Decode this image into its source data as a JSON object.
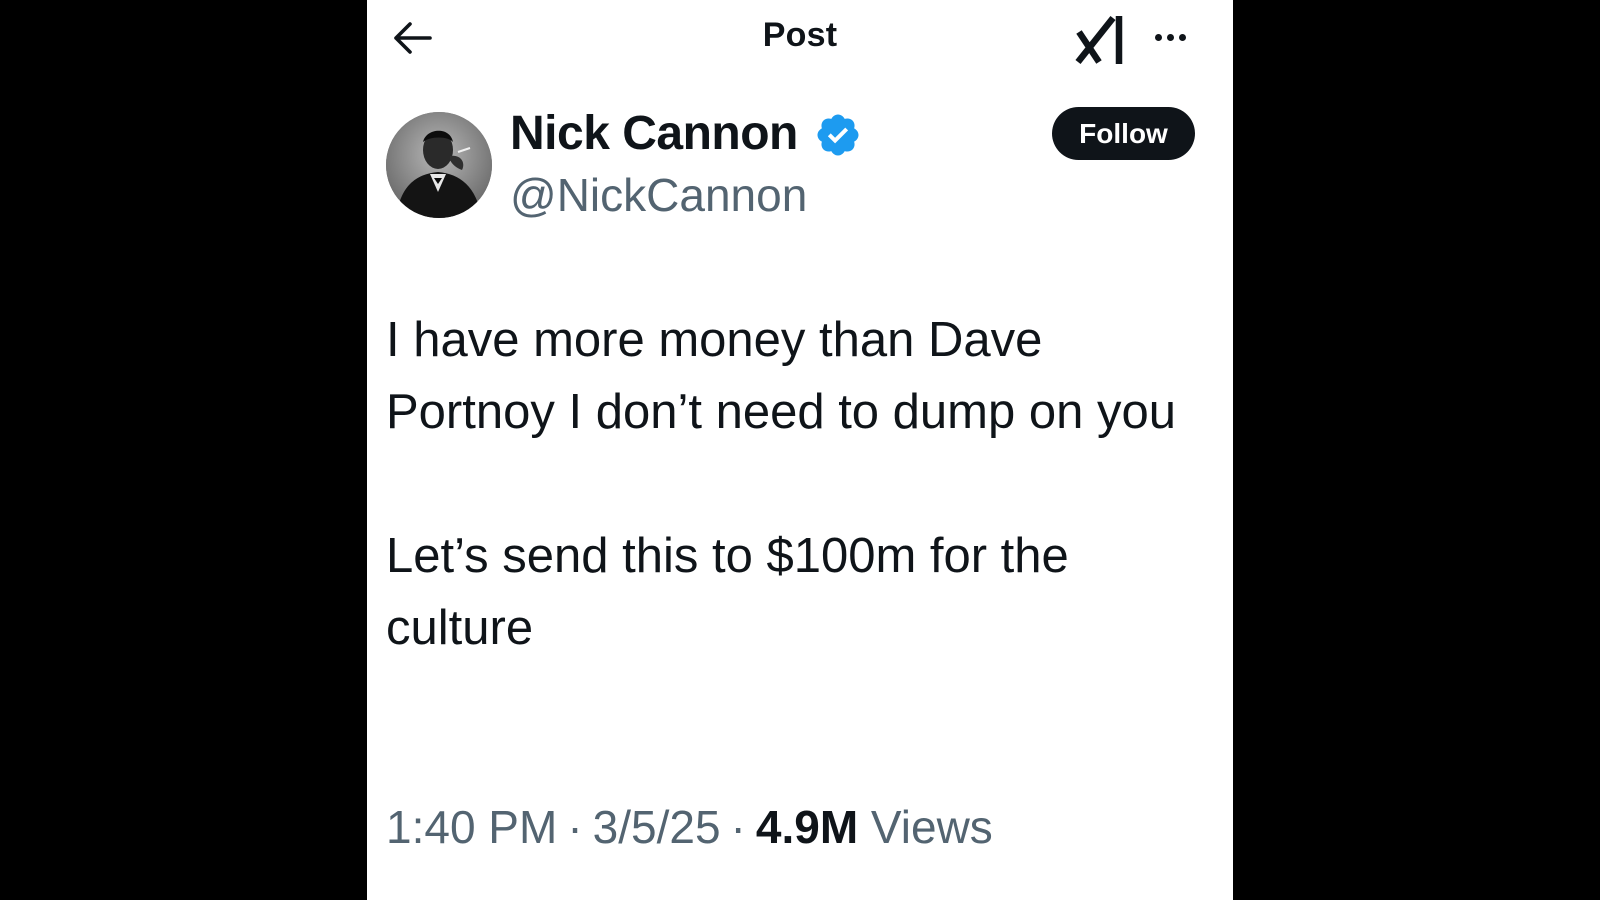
{
  "header": {
    "title": "Post",
    "back_icon": "arrow-left-icon",
    "grok_icon": "grok-icon",
    "more_icon": "more-horizontal-icon"
  },
  "author": {
    "name": "Nick Cannon",
    "handle": "@NickCannon",
    "verified_icon": "verified-badge-icon",
    "verified_color": "#1d9bf0",
    "follow_label": "Follow"
  },
  "tweet": {
    "paragraphs": [
      "I have more money than Dave Portnoy I don’t need to dump on you",
      "Let’s send this to $100m for the culture"
    ]
  },
  "meta": {
    "time": "1:40 PM",
    "separator": "·",
    "date": "3/5/25",
    "views_count": "4.9M",
    "views_label": "Views"
  },
  "colors": {
    "text_primary": "#0f1419",
    "text_secondary": "#536471",
    "background": "#ffffff",
    "outer_background": "#000000"
  }
}
